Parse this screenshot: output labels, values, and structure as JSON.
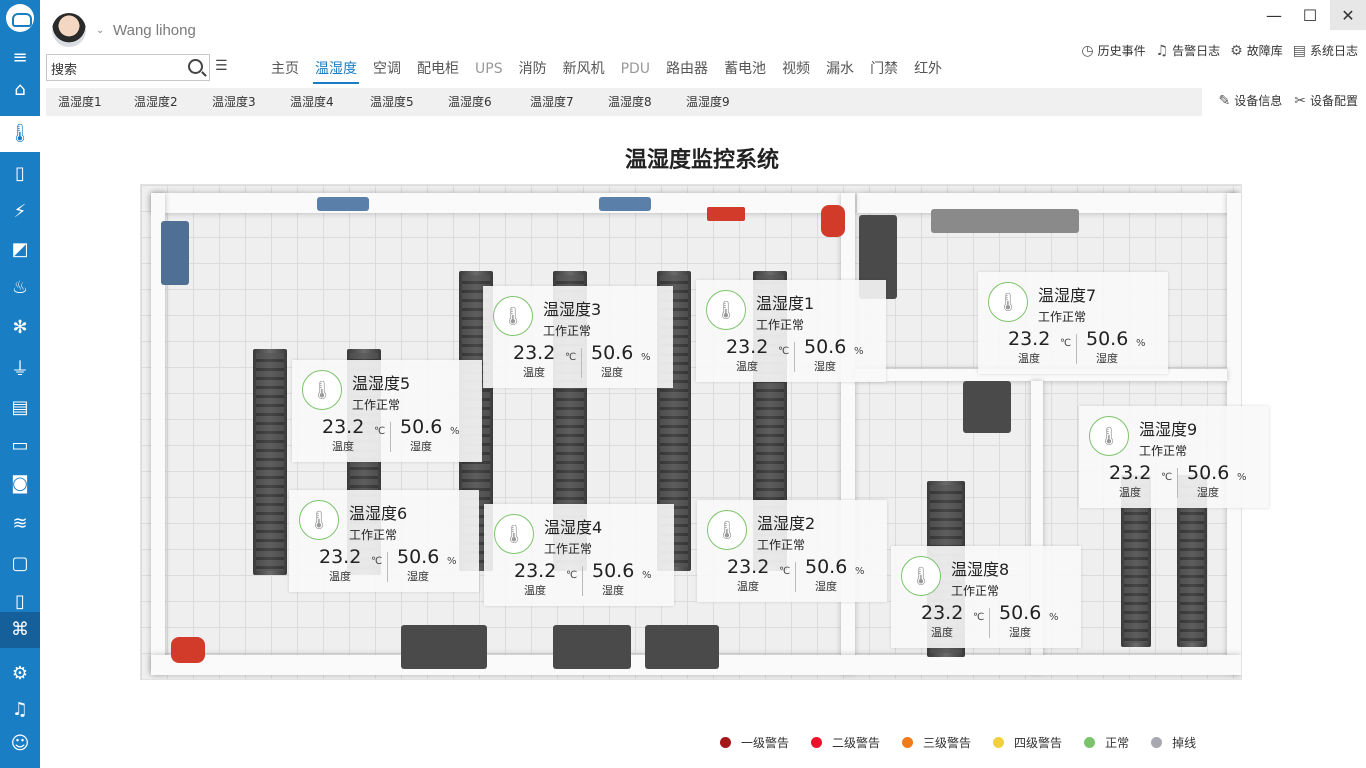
{
  "user": {
    "name": "Wang lihong"
  },
  "search": {
    "value": "搜索"
  },
  "main_tabs": [
    {
      "label": "主页",
      "state": "normal"
    },
    {
      "label": "温湿度",
      "state": "active"
    },
    {
      "label": "空调",
      "state": "normal"
    },
    {
      "label": "配电柜",
      "state": "normal"
    },
    {
      "label": "UPS",
      "state": "dim"
    },
    {
      "label": "消防",
      "state": "normal"
    },
    {
      "label": "新风机",
      "state": "normal"
    },
    {
      "label": "PDU",
      "state": "dim"
    },
    {
      "label": "路由器",
      "state": "normal"
    },
    {
      "label": "蓄电池",
      "state": "normal"
    },
    {
      "label": "视频",
      "state": "normal"
    },
    {
      "label": "漏水",
      "state": "normal"
    },
    {
      "label": "门禁",
      "state": "normal"
    },
    {
      "label": "红外",
      "state": "normal"
    }
  ],
  "top_actions": [
    {
      "label": "历史事件",
      "icon": "clock-icon"
    },
    {
      "label": "告警日志",
      "icon": "alarm-icon"
    },
    {
      "label": "故障库",
      "icon": "gear-icon"
    },
    {
      "label": "系统日志",
      "icon": "document-icon"
    }
  ],
  "sub_tabs": [
    "温湿度1",
    "温湿度2",
    "温湿度3",
    "温湿度4",
    "温湿度5",
    "温湿度6",
    "温湿度7",
    "温湿度8",
    "温湿度9"
  ],
  "sub_actions": [
    {
      "label": "设备信息",
      "icon": "edit-icon"
    },
    {
      "label": "设备配置",
      "icon": "tools-icon"
    }
  ],
  "page_title": "温湿度监控系统",
  "sensors": [
    {
      "name": "温湿度1",
      "status": "工作正常",
      "temp": "23.2",
      "temp_unit": "℃",
      "temp_label": "温度",
      "hum": "50.6",
      "hum_unit": "%",
      "hum_label": "湿度"
    },
    {
      "name": "温湿度2",
      "status": "工作正常",
      "temp": "23.2",
      "temp_unit": "℃",
      "temp_label": "温度",
      "hum": "50.6",
      "hum_unit": "%",
      "hum_label": "湿度"
    },
    {
      "name": "温湿度3",
      "status": "工作正常",
      "temp": "23.2",
      "temp_unit": "℃",
      "temp_label": "温度",
      "hum": "50.6",
      "hum_unit": "%",
      "hum_label": "湿度"
    },
    {
      "name": "温湿度4",
      "status": "工作正常",
      "temp": "23.2",
      "temp_unit": "℃",
      "temp_label": "温度",
      "hum": "50.6",
      "hum_unit": "%",
      "hum_label": "湿度"
    },
    {
      "name": "温湿度5",
      "status": "工作正常",
      "temp": "23.2",
      "temp_unit": "℃",
      "temp_label": "温度",
      "hum": "50.6",
      "hum_unit": "%",
      "hum_label": "湿度"
    },
    {
      "name": "温湿度6",
      "status": "工作正常",
      "temp": "23.2",
      "temp_unit": "℃",
      "temp_label": "温度",
      "hum": "50.6",
      "hum_unit": "%",
      "hum_label": "湿度"
    },
    {
      "name": "温湿度7",
      "status": "工作正常",
      "temp": "23.2",
      "temp_unit": "℃",
      "temp_label": "温度",
      "hum": "50.6",
      "hum_unit": "%",
      "hum_label": "湿度"
    },
    {
      "name": "温湿度8",
      "status": "工作正常",
      "temp": "23.2",
      "temp_unit": "℃",
      "temp_label": "温度",
      "hum": "50.6",
      "hum_unit": "%",
      "hum_label": "湿度"
    },
    {
      "name": "温湿度9",
      "status": "工作正常",
      "temp": "23.2",
      "temp_unit": "℃",
      "temp_label": "温度",
      "hum": "50.6",
      "hum_unit": "%",
      "hum_label": "湿度"
    }
  ],
  "legend": [
    {
      "label": "一级警告",
      "color": "#a4161a"
    },
    {
      "label": "二级警告",
      "color": "#e8142c"
    },
    {
      "label": "三级警告",
      "color": "#f07b1a"
    },
    {
      "label": "四级警告",
      "color": "#f0d040"
    },
    {
      "label": "正常",
      "color": "#7cc46b"
    },
    {
      "label": "掉线",
      "color": "#a8a8b0"
    }
  ],
  "colors": {
    "accent": "#1a7ec5",
    "sensor_ring": "#7cc46b"
  },
  "sidebar_icons": [
    "menu-icon",
    "home-icon",
    "thermometer-icon",
    "aircon-icon",
    "power-cabinet-icon",
    "ups-icon",
    "fire-extinguisher-icon",
    "fan-icon",
    "pdu-icon",
    "router-icon",
    "battery-icon",
    "camera-icon",
    "water-leak-icon",
    "door-lock-icon",
    "infrared-icon",
    "device-group-icon",
    "settings-icon",
    "alarm-bell-icon",
    "users-icon"
  ]
}
